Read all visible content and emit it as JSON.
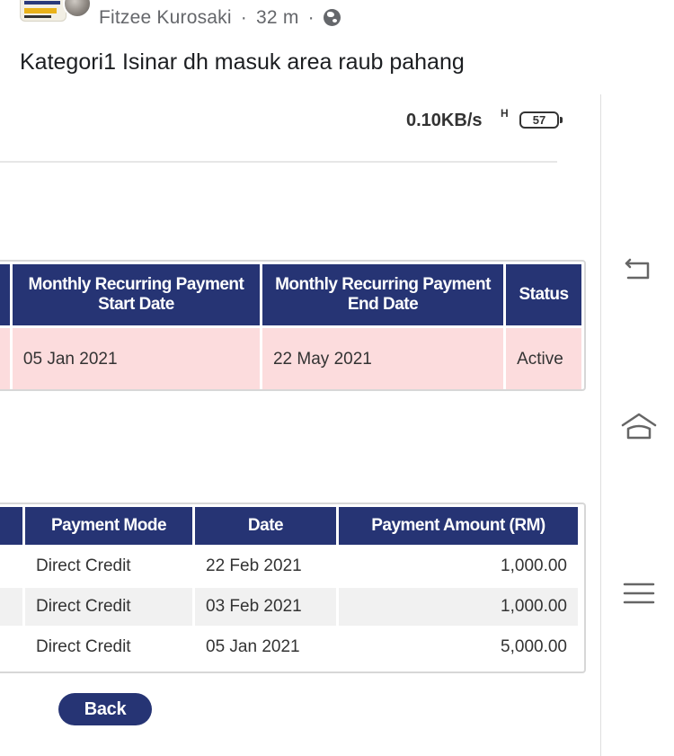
{
  "post": {
    "author": "Fitzee Kurosaki",
    "separator": "·",
    "time": "32 m",
    "privacy_icon": "globe-icon",
    "text": "Kategori1 Isinar dh masuk area raub pahang"
  },
  "status_bar": {
    "network_speed": "0.10KB/s",
    "network_type": "H",
    "battery_level": "57"
  },
  "recurring_table": {
    "headers": [
      "Monthly Recurring Payment Start Date",
      "Monthly Recurring Payment End Date",
      "Status"
    ],
    "rows": [
      {
        "start": "05 Jan 2021",
        "end": "22 May 2021",
        "status": "Active"
      }
    ]
  },
  "payments_table": {
    "headers": [
      "Payment Mode",
      "Date",
      "Payment Amount (RM)"
    ],
    "rows": [
      {
        "mode": "Direct Credit",
        "date": "22 Feb 2021",
        "amount": "1,000.00"
      },
      {
        "mode": "Direct Credit",
        "date": "03 Feb 2021",
        "amount": "1,000.00"
      },
      {
        "mode": "Direct Credit",
        "date": "05 Jan 2021",
        "amount": "5,000.00"
      }
    ]
  },
  "back_button": {
    "label": "Back"
  },
  "nav": {
    "back_icon": "back-arrow-icon",
    "home_icon": "home-icon",
    "menu_icon": "menu-icon"
  },
  "colors": {
    "header_blue": "#263474",
    "active_row_pink": "#fcdcdd",
    "alt_row_gray": "#f1f1f1"
  }
}
